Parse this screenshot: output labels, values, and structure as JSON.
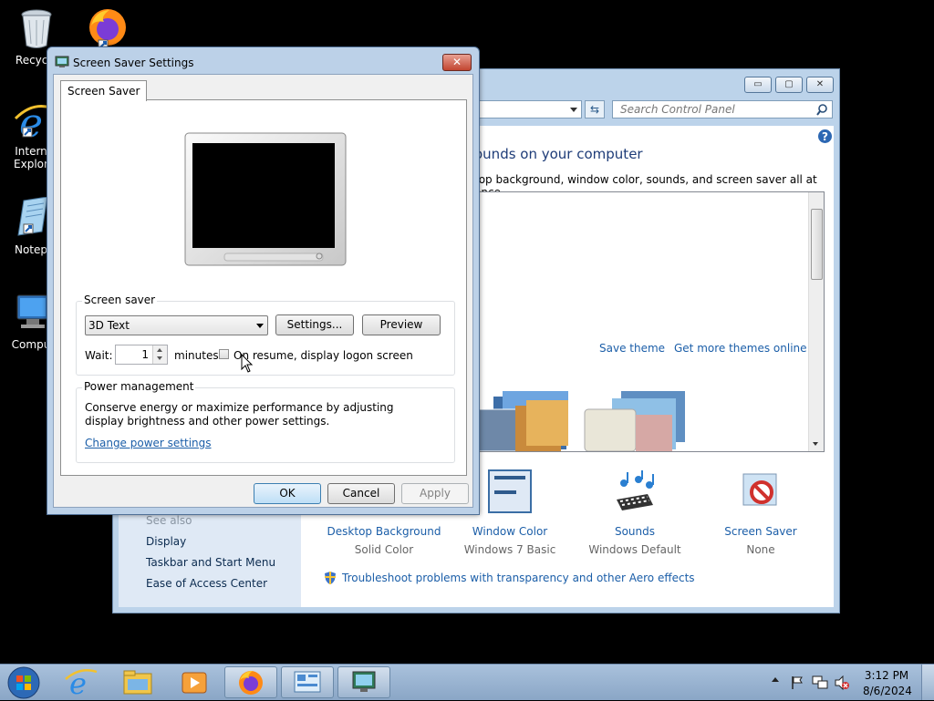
{
  "desktop": {
    "icons": [
      {
        "name": "recycle-bin-icon",
        "label": "Recycle"
      },
      {
        "name": "firefox-desktop-icon",
        "label": ""
      },
      {
        "name": "internet-explorer-icon",
        "label": "Intern",
        "label2": "Explor"
      },
      {
        "name": "notepad-icon",
        "label": "Notep"
      },
      {
        "name": "computer-icon",
        "label": "Compu"
      }
    ]
  },
  "control_panel": {
    "search_placeholder": "Search Control Panel",
    "heading": "ounds on your computer",
    "subheading": "top background, window color, sounds, and screen saver all at once.",
    "save_theme": "Save theme",
    "get_more_themes": "Get more themes online",
    "see_also": "See also",
    "left_links": [
      "Display",
      "Taskbar and Start Menu",
      "Ease of Access Center"
    ],
    "bottom_items": [
      {
        "title": "Desktop Background",
        "value": "Solid Color"
      },
      {
        "title": "Window Color",
        "value": "Windows 7 Basic"
      },
      {
        "title": "Sounds",
        "value": "Windows Default"
      },
      {
        "title": "Screen Saver",
        "value": "None"
      }
    ],
    "troubleshoot": "Troubleshoot problems with transparency and other Aero effects"
  },
  "dialog": {
    "title": "Screen Saver Settings",
    "close": "✕",
    "tab": "Screen Saver",
    "screen_saver_group": "Screen saver",
    "screen_saver_value": "3D Text",
    "settings_button": "Settings...",
    "preview_button": "Preview",
    "wait_label": "Wait:",
    "wait_value": "1",
    "minutes_label": "minutes",
    "resume_label": "On resume, display logon screen",
    "power_group": "Power management",
    "power_text": "Conserve energy or maximize performance by adjusting display brightness and other power settings.",
    "change_power_link": "Change power settings",
    "ok": "OK",
    "cancel": "Cancel",
    "apply": "Apply"
  },
  "taskbar": {
    "time": "3:12 PM",
    "date": "8/6/2024"
  },
  "colors": {
    "link": "#1b5ea8",
    "dialog_frame": "#bcd1e8",
    "taskbar": "#9bb5d3"
  }
}
